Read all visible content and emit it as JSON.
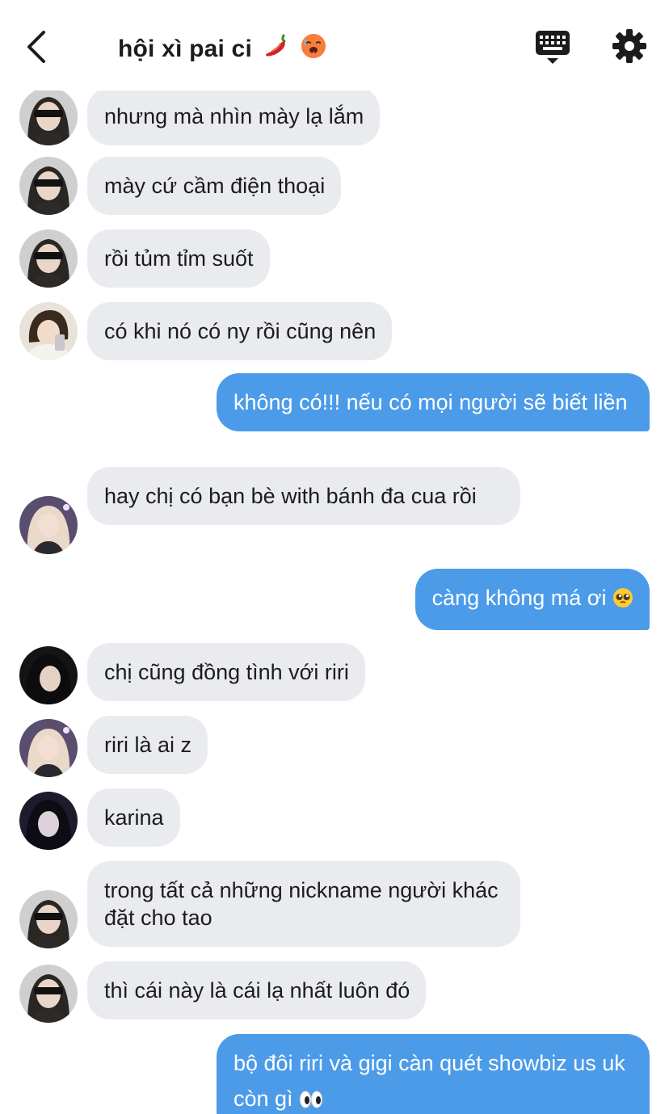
{
  "header": {
    "title": "hội xì pai ci",
    "icons": [
      "back-chevron-icon",
      "keyboard-icon",
      "gear-icon"
    ],
    "title_emoji": [
      "chili-pepper",
      "hot-face"
    ]
  },
  "colors": {
    "incoming_bubble": "#e9ebef",
    "outgoing_bubble": "#4c9be8",
    "text_dark": "#1c1c1e",
    "text_light": "#ffffff"
  },
  "messages": [
    {
      "side": "in",
      "avatar": "avatar-sunglasses-girl",
      "text": "nhưng mà nhìn mày lạ lắm"
    },
    {
      "side": "in",
      "avatar": "avatar-sunglasses-girl",
      "text": "mày cứ cầm điện thoại"
    },
    {
      "side": "in",
      "avatar": "avatar-sunglasses-girl",
      "text": "rồi tủm tỉm suốt"
    },
    {
      "side": "in",
      "avatar": "avatar-blonde-phone-girl",
      "text": "có khi nó có ny rồi cũng nên"
    },
    {
      "side": "out",
      "text": "không có!!! nếu có mọi người sẽ biết liền"
    },
    {
      "side": "in",
      "avatar": "avatar-pink-hair-girl",
      "text": "hay chị có bạn bè with bánh đa cua rồi"
    },
    {
      "side": "out",
      "text": "càng không má ơi",
      "emoji": "pleading-face"
    },
    {
      "side": "in",
      "avatar": "avatar-dark-hair-girl",
      "text": "chị cũng đồng tình với riri"
    },
    {
      "side": "in",
      "avatar": "avatar-pink-hair-girl",
      "text": "riri là ai z"
    },
    {
      "side": "in",
      "avatar": "avatar-dark-hair-girl-2",
      "text": "karina"
    },
    {
      "side": "in",
      "avatar": "avatar-sunglasses-girl",
      "text": "trong tất cả những nickname người khác đặt cho tao"
    },
    {
      "side": "in",
      "avatar": "avatar-sunglasses-girl",
      "text": "thì cái này là cái lạ nhất luôn đó"
    },
    {
      "side": "out",
      "text": "bộ đôi riri và gigi càn quét showbiz us uk còn gì",
      "emoji": "eyes"
    }
  ]
}
